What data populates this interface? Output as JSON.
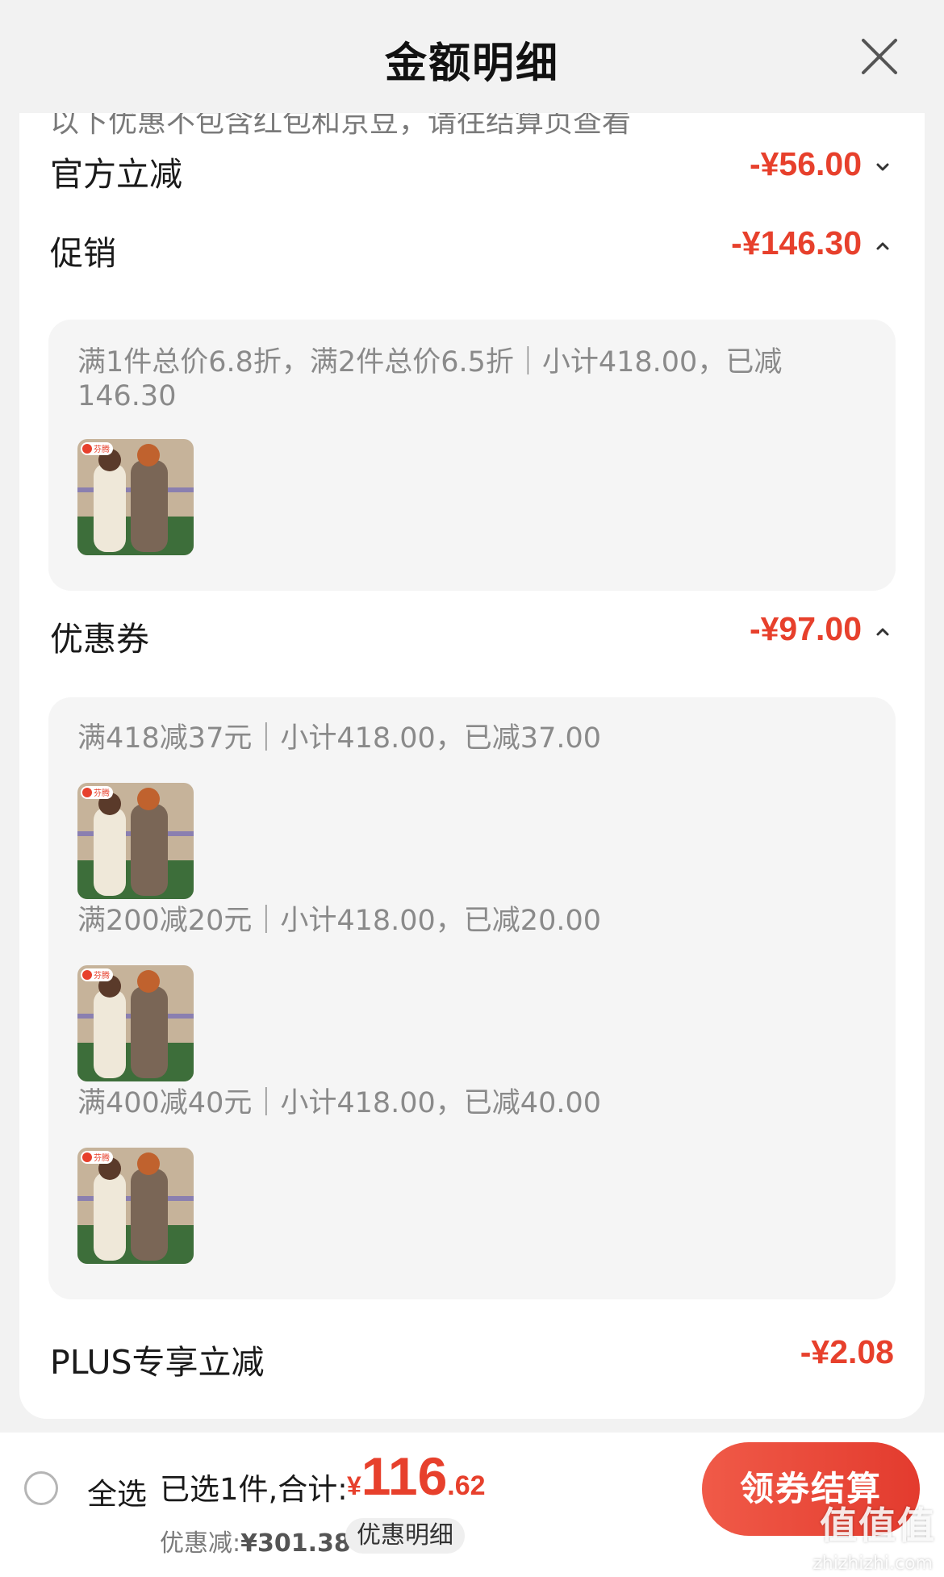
{
  "header": {
    "title": "金额明细"
  },
  "notice": "以下优惠不包含红包和京豆，请往结算页查看",
  "rows": {
    "official": {
      "label": "官方立减",
      "amount": "-¥56.00",
      "expanded": false
    },
    "promo": {
      "label": "促销",
      "amount": "-¥146.30",
      "expanded": true,
      "desc": "满1件总价6.8折，满2件总价6.5折｜小计418.00，已减146.30"
    },
    "coupon": {
      "label": "优惠券",
      "amount": "-¥97.00",
      "expanded": true,
      "items": [
        {
          "desc": "满418减37元｜小计418.00，已减37.00"
        },
        {
          "desc": "满200减20元｜小计418.00，已减20.00"
        },
        {
          "desc": "满400减40元｜小计418.00，已减40.00"
        }
      ]
    },
    "plus": {
      "label": "PLUS专享立减",
      "amount": "-¥2.08"
    }
  },
  "thumb": {
    "brand": "芬腾"
  },
  "footer": {
    "select_all": "全选",
    "summary_label": "已选1件,合计:",
    "currency": "¥",
    "total_int": "116",
    "total_dec": ".62",
    "discount_label": "优惠减:",
    "discount_value": "¥301.38",
    "detail_button": "优惠明细",
    "checkout_button": "领券结算"
  },
  "watermark": {
    "main": "值值值",
    "sub": "zhizhizhi.com"
  },
  "colors": {
    "accent": "#e7402c",
    "background": "#f2f2f2"
  }
}
